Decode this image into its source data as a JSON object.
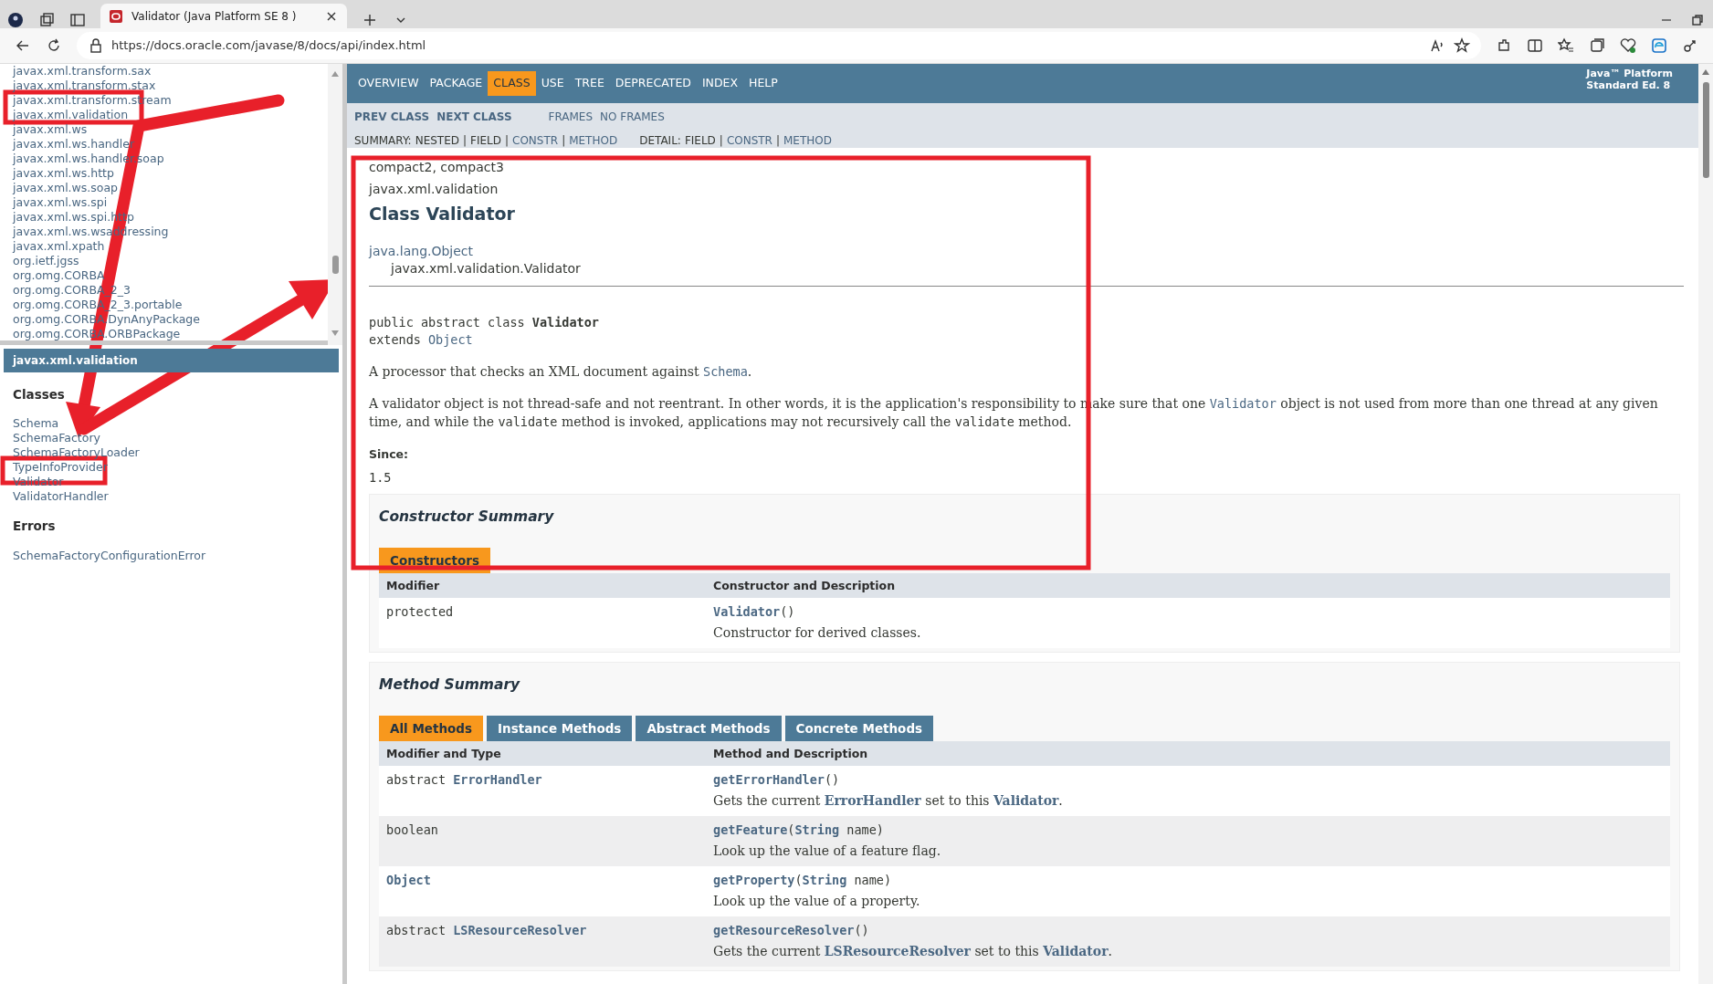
{
  "browser": {
    "tab_title": "Validator (Java Platform SE 8 )",
    "url": "https://docs.oracle.com/javase/8/docs/api/index.html"
  },
  "package_list": [
    "javax.xml.transform.sax",
    "javax.xml.transform.stax",
    "javax.xml.transform.stream",
    "javax.xml.validation",
    "javax.xml.ws",
    "javax.xml.ws.handler",
    "javax.xml.ws.handler.soap",
    "javax.xml.ws.http",
    "javax.xml.ws.soap",
    "javax.xml.ws.spi",
    "javax.xml.ws.spi.http",
    "javax.xml.ws.wsaddressing",
    "javax.xml.xpath",
    "org.ietf.jgss",
    "org.omg.CORBA",
    "org.omg.CORBA_2_3",
    "org.omg.CORBA_2_3.portable",
    "org.omg.CORBA.DynAnyPackage",
    "org.omg.CORBA.ORBPackage"
  ],
  "package_frame": {
    "title": "javax.xml.validation",
    "sections": [
      {
        "heading": "Classes",
        "items": [
          "Schema",
          "SchemaFactory",
          "SchemaFactoryLoader",
          "TypeInfoProvider",
          "Validator",
          "ValidatorHandler"
        ]
      },
      {
        "heading": "Errors",
        "items": [
          "SchemaFactoryConfigurationError"
        ]
      }
    ]
  },
  "top_nav": {
    "items": [
      {
        "label": "OVERVIEW",
        "selected": false
      },
      {
        "label": "PACKAGE",
        "selected": false
      },
      {
        "label": "CLASS",
        "selected": true
      },
      {
        "label": "USE",
        "selected": false
      },
      {
        "label": "TREE",
        "selected": false
      },
      {
        "label": "DEPRECATED",
        "selected": false
      },
      {
        "label": "INDEX",
        "selected": false
      },
      {
        "label": "HELP",
        "selected": false
      }
    ],
    "platform": [
      "Java™ Platform",
      "Standard Ed. 8"
    ]
  },
  "sub_nav": {
    "class_links": [
      "PREV CLASS",
      "NEXT CLASS"
    ],
    "frame_links": [
      "FRAMES",
      "NO FRAMES"
    ],
    "summary": {
      "label": "SUMMARY:",
      "items": [
        {
          "text": "NESTED",
          "kind": "plain"
        },
        {
          "text": "|",
          "kind": "separator"
        },
        {
          "text": "FIELD",
          "kind": "plain"
        },
        {
          "text": "|",
          "kind": "separator"
        },
        {
          "text": "CONSTR",
          "kind": "link"
        },
        {
          "text": "|",
          "kind": "separator"
        },
        {
          "text": "METHOD",
          "kind": "link"
        }
      ]
    },
    "detail": {
      "label": "DETAIL:",
      "items": [
        {
          "text": "FIELD",
          "kind": "plain"
        },
        {
          "text": "|",
          "kind": "separator"
        },
        {
          "text": "CONSTR",
          "kind": "link"
        },
        {
          "text": "|",
          "kind": "separator"
        },
        {
          "text": "METHOD",
          "kind": "link"
        }
      ]
    }
  },
  "class_header": {
    "profiles": "compact2, compact3",
    "package": "javax.xml.validation",
    "title": "Class Validator",
    "inheritance": [
      "java.lang.Object",
      "javax.xml.validation.Validator"
    ]
  },
  "declaration": {
    "signature": "public abstract class **Validator**",
    "extends_keyword": "extends",
    "extends_type": "Object"
  },
  "description": [
    [
      {
        "kind": "text",
        "text": "A processor that checks an XML document against "
      },
      {
        "kind": "link",
        "text": "Schema"
      },
      {
        "kind": "text",
        "text": "."
      }
    ],
    [
      {
        "kind": "text",
        "text": "A validator object is not thread-safe and not reentrant. In other words, it is the application's responsibility to make sure that one "
      },
      {
        "kind": "link",
        "text": "Validator"
      },
      {
        "kind": "text",
        "text": " object is not used from more than one thread at any given time, and while the "
      },
      {
        "kind": "code",
        "text": "validate"
      },
      {
        "kind": "text",
        "text": " method is invoked, applications may not recursively call the "
      },
      {
        "kind": "code",
        "text": "validate"
      },
      {
        "kind": "text",
        "text": " method."
      }
    ]
  ],
  "since": {
    "label": "Since:",
    "value": "1.5"
  },
  "constructor_summary": {
    "title": "Constructor Summary",
    "tabs": [
      {
        "label": "Constructors",
        "selected": true
      }
    ],
    "columns": [
      "Modifier",
      "Constructor and Description"
    ],
    "rows": [
      {
        "modifier": [
          {
            "kind": "text",
            "text": "protected"
          }
        ],
        "signature": [
          {
            "kind": "link",
            "text": "Validator"
          },
          {
            "kind": "text",
            "text": "()"
          }
        ],
        "description": [
          {
            "kind": "text",
            "text": "Constructor for derived classes."
          }
        ]
      }
    ]
  },
  "method_summary": {
    "title": "Method Summary",
    "tabs": [
      {
        "label": "All Methods",
        "selected": true
      },
      {
        "label": "Instance Methods",
        "selected": false
      },
      {
        "label": "Abstract Methods",
        "selected": false
      },
      {
        "label": "Concrete Methods",
        "selected": false
      }
    ],
    "columns": [
      "Modifier and Type",
      "Method and Description"
    ],
    "rows": [
      {
        "modifier": [
          {
            "kind": "text",
            "text": "abstract "
          },
          {
            "kind": "link",
            "text": "ErrorHandler"
          }
        ],
        "signature": [
          {
            "kind": "link",
            "text": "getErrorHandler"
          },
          {
            "kind": "text",
            "text": "()"
          }
        ],
        "description": [
          {
            "kind": "text",
            "text": "Gets the current "
          },
          {
            "kind": "link",
            "text": "ErrorHandler"
          },
          {
            "kind": "text",
            "text": " set to this "
          },
          {
            "kind": "link",
            "text": "Validator"
          },
          {
            "kind": "text",
            "text": "."
          }
        ]
      },
      {
        "modifier": [
          {
            "kind": "text",
            "text": "boolean"
          }
        ],
        "signature": [
          {
            "kind": "link",
            "text": "getFeature"
          },
          {
            "kind": "text",
            "text": "("
          },
          {
            "kind": "link",
            "text": "String"
          },
          {
            "kind": "text",
            "text": " name)"
          }
        ],
        "description": [
          {
            "kind": "text",
            "text": "Look up the value of a feature flag."
          }
        ]
      },
      {
        "modifier": [
          {
            "kind": "link",
            "text": "Object"
          }
        ],
        "signature": [
          {
            "kind": "link",
            "text": "getProperty"
          },
          {
            "kind": "text",
            "text": "("
          },
          {
            "kind": "link",
            "text": "String"
          },
          {
            "kind": "text",
            "text": " name)"
          }
        ],
        "description": [
          {
            "kind": "text",
            "text": "Look up the value of a property."
          }
        ]
      },
      {
        "modifier": [
          {
            "kind": "text",
            "text": "abstract "
          },
          {
            "kind": "link",
            "text": "LSResourceResolver"
          }
        ],
        "signature": [
          {
            "kind": "link",
            "text": "getResourceResolver"
          },
          {
            "kind": "text",
            "text": "()"
          }
        ],
        "description": [
          {
            "kind": "text",
            "text": "Gets the current "
          },
          {
            "kind": "link",
            "text": "LSResourceResolver"
          },
          {
            "kind": "text",
            "text": " set to this "
          },
          {
            "kind": "link",
            "text": "Validator"
          },
          {
            "kind": "text",
            "text": "."
          }
        ]
      }
    ]
  }
}
